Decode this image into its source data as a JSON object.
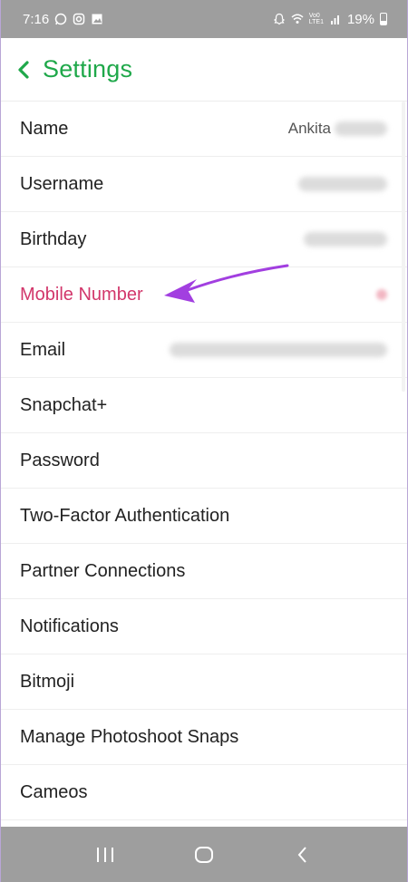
{
  "status_bar": {
    "time": "7:16",
    "battery": "19%",
    "left_icons": [
      "whatsapp-icon",
      "instagram-icon",
      "gallery-icon"
    ],
    "right_icons": [
      "snapchat-ghost-icon",
      "wifi-icon",
      "volte-lte-icon",
      "signal-icon",
      "battery-icon"
    ],
    "volte_label": "Vo0",
    "lte_label": "LTE1"
  },
  "header": {
    "title": "Settings",
    "back_icon": "chevron-left-icon"
  },
  "settings": {
    "items": [
      {
        "label": "Name",
        "value": "Ankita"
      },
      {
        "label": "Username"
      },
      {
        "label": "Birthday"
      },
      {
        "label": "Mobile Number"
      },
      {
        "label": "Email"
      },
      {
        "label": "Snapchat+"
      },
      {
        "label": "Password"
      },
      {
        "label": "Two-Factor Authentication"
      },
      {
        "label": "Partner Connections"
      },
      {
        "label": "Notifications"
      },
      {
        "label": "Bitmoji"
      },
      {
        "label": "Manage Photoshoot Snaps"
      },
      {
        "label": "Cameos"
      }
    ]
  },
  "colors": {
    "accent_green": "#1fa84a",
    "highlight_pink": "#d2376b",
    "arrow_purple": "#a23fe0",
    "bars_gray": "#9e9e9e"
  },
  "nav_bar": {
    "icons": [
      "recent-apps-icon",
      "home-icon",
      "back-icon"
    ]
  }
}
